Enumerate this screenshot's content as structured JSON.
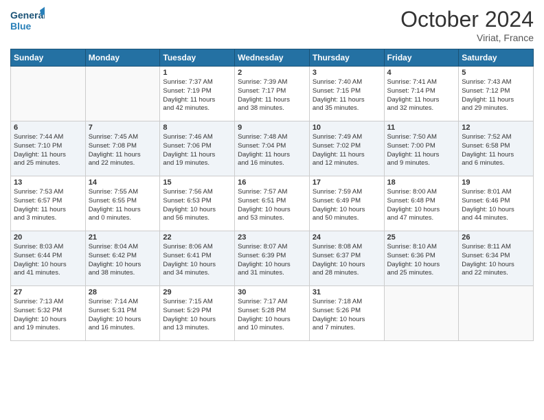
{
  "header": {
    "logo_line1": "General",
    "logo_line2": "Blue",
    "month": "October 2024",
    "location": "Viriat, France"
  },
  "days_of_week": [
    "Sunday",
    "Monday",
    "Tuesday",
    "Wednesday",
    "Thursday",
    "Friday",
    "Saturday"
  ],
  "weeks": [
    [
      {
        "num": "",
        "empty": true
      },
      {
        "num": "",
        "empty": true
      },
      {
        "num": "1",
        "line1": "Sunrise: 7:37 AM",
        "line2": "Sunset: 7:19 PM",
        "line3": "Daylight: 11 hours",
        "line4": "and 42 minutes."
      },
      {
        "num": "2",
        "line1": "Sunrise: 7:39 AM",
        "line2": "Sunset: 7:17 PM",
        "line3": "Daylight: 11 hours",
        "line4": "and 38 minutes."
      },
      {
        "num": "3",
        "line1": "Sunrise: 7:40 AM",
        "line2": "Sunset: 7:15 PM",
        "line3": "Daylight: 11 hours",
        "line4": "and 35 minutes."
      },
      {
        "num": "4",
        "line1": "Sunrise: 7:41 AM",
        "line2": "Sunset: 7:14 PM",
        "line3": "Daylight: 11 hours",
        "line4": "and 32 minutes."
      },
      {
        "num": "5",
        "line1": "Sunrise: 7:43 AM",
        "line2": "Sunset: 7:12 PM",
        "line3": "Daylight: 11 hours",
        "line4": "and 29 minutes."
      }
    ],
    [
      {
        "num": "6",
        "line1": "Sunrise: 7:44 AM",
        "line2": "Sunset: 7:10 PM",
        "line3": "Daylight: 11 hours",
        "line4": "and 25 minutes."
      },
      {
        "num": "7",
        "line1": "Sunrise: 7:45 AM",
        "line2": "Sunset: 7:08 PM",
        "line3": "Daylight: 11 hours",
        "line4": "and 22 minutes."
      },
      {
        "num": "8",
        "line1": "Sunrise: 7:46 AM",
        "line2": "Sunset: 7:06 PM",
        "line3": "Daylight: 11 hours",
        "line4": "and 19 minutes."
      },
      {
        "num": "9",
        "line1": "Sunrise: 7:48 AM",
        "line2": "Sunset: 7:04 PM",
        "line3": "Daylight: 11 hours",
        "line4": "and 16 minutes."
      },
      {
        "num": "10",
        "line1": "Sunrise: 7:49 AM",
        "line2": "Sunset: 7:02 PM",
        "line3": "Daylight: 11 hours",
        "line4": "and 12 minutes."
      },
      {
        "num": "11",
        "line1": "Sunrise: 7:50 AM",
        "line2": "Sunset: 7:00 PM",
        "line3": "Daylight: 11 hours",
        "line4": "and 9 minutes."
      },
      {
        "num": "12",
        "line1": "Sunrise: 7:52 AM",
        "line2": "Sunset: 6:58 PM",
        "line3": "Daylight: 11 hours",
        "line4": "and 6 minutes."
      }
    ],
    [
      {
        "num": "13",
        "line1": "Sunrise: 7:53 AM",
        "line2": "Sunset: 6:57 PM",
        "line3": "Daylight: 11 hours",
        "line4": "and 3 minutes."
      },
      {
        "num": "14",
        "line1": "Sunrise: 7:55 AM",
        "line2": "Sunset: 6:55 PM",
        "line3": "Daylight: 11 hours",
        "line4": "and 0 minutes."
      },
      {
        "num": "15",
        "line1": "Sunrise: 7:56 AM",
        "line2": "Sunset: 6:53 PM",
        "line3": "Daylight: 10 hours",
        "line4": "and 56 minutes."
      },
      {
        "num": "16",
        "line1": "Sunrise: 7:57 AM",
        "line2": "Sunset: 6:51 PM",
        "line3": "Daylight: 10 hours",
        "line4": "and 53 minutes."
      },
      {
        "num": "17",
        "line1": "Sunrise: 7:59 AM",
        "line2": "Sunset: 6:49 PM",
        "line3": "Daylight: 10 hours",
        "line4": "and 50 minutes."
      },
      {
        "num": "18",
        "line1": "Sunrise: 8:00 AM",
        "line2": "Sunset: 6:48 PM",
        "line3": "Daylight: 10 hours",
        "line4": "and 47 minutes."
      },
      {
        "num": "19",
        "line1": "Sunrise: 8:01 AM",
        "line2": "Sunset: 6:46 PM",
        "line3": "Daylight: 10 hours",
        "line4": "and 44 minutes."
      }
    ],
    [
      {
        "num": "20",
        "line1": "Sunrise: 8:03 AM",
        "line2": "Sunset: 6:44 PM",
        "line3": "Daylight: 10 hours",
        "line4": "and 41 minutes."
      },
      {
        "num": "21",
        "line1": "Sunrise: 8:04 AM",
        "line2": "Sunset: 6:42 PM",
        "line3": "Daylight: 10 hours",
        "line4": "and 38 minutes."
      },
      {
        "num": "22",
        "line1": "Sunrise: 8:06 AM",
        "line2": "Sunset: 6:41 PM",
        "line3": "Daylight: 10 hours",
        "line4": "and 34 minutes."
      },
      {
        "num": "23",
        "line1": "Sunrise: 8:07 AM",
        "line2": "Sunset: 6:39 PM",
        "line3": "Daylight: 10 hours",
        "line4": "and 31 minutes."
      },
      {
        "num": "24",
        "line1": "Sunrise: 8:08 AM",
        "line2": "Sunset: 6:37 PM",
        "line3": "Daylight: 10 hours",
        "line4": "and 28 minutes."
      },
      {
        "num": "25",
        "line1": "Sunrise: 8:10 AM",
        "line2": "Sunset: 6:36 PM",
        "line3": "Daylight: 10 hours",
        "line4": "and 25 minutes."
      },
      {
        "num": "26",
        "line1": "Sunrise: 8:11 AM",
        "line2": "Sunset: 6:34 PM",
        "line3": "Daylight: 10 hours",
        "line4": "and 22 minutes."
      }
    ],
    [
      {
        "num": "27",
        "line1": "Sunrise: 7:13 AM",
        "line2": "Sunset: 5:32 PM",
        "line3": "Daylight: 10 hours",
        "line4": "and 19 minutes."
      },
      {
        "num": "28",
        "line1": "Sunrise: 7:14 AM",
        "line2": "Sunset: 5:31 PM",
        "line3": "Daylight: 10 hours",
        "line4": "and 16 minutes."
      },
      {
        "num": "29",
        "line1": "Sunrise: 7:15 AM",
        "line2": "Sunset: 5:29 PM",
        "line3": "Daylight: 10 hours",
        "line4": "and 13 minutes."
      },
      {
        "num": "30",
        "line1": "Sunrise: 7:17 AM",
        "line2": "Sunset: 5:28 PM",
        "line3": "Daylight: 10 hours",
        "line4": "and 10 minutes."
      },
      {
        "num": "31",
        "line1": "Sunrise: 7:18 AM",
        "line2": "Sunset: 5:26 PM",
        "line3": "Daylight: 10 hours",
        "line4": "and 7 minutes."
      },
      {
        "num": "",
        "empty": true
      },
      {
        "num": "",
        "empty": true
      }
    ]
  ]
}
